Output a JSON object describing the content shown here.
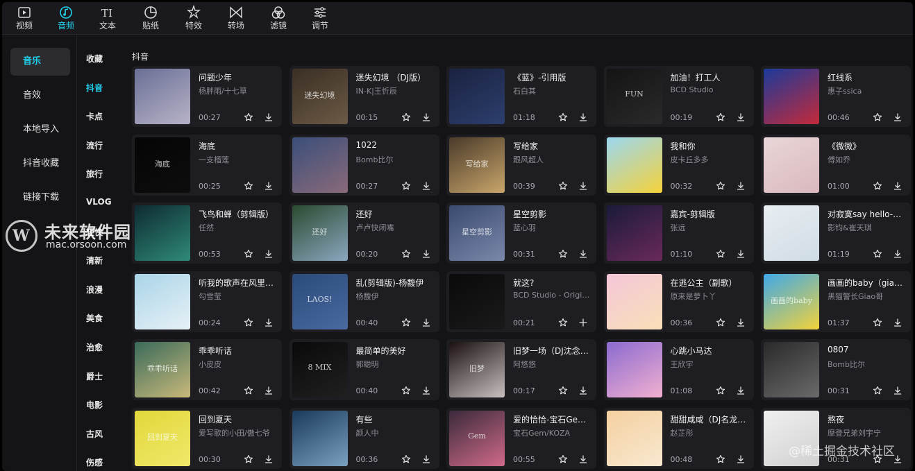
{
  "toolbar": {
    "tools": [
      {
        "label": "视频",
        "icon": "video-icon"
      },
      {
        "label": "音频",
        "icon": "audio-icon"
      },
      {
        "label": "文本",
        "icon": "text-icon"
      },
      {
        "label": "贴纸",
        "icon": "sticker-icon"
      },
      {
        "label": "特效",
        "icon": "effects-icon"
      },
      {
        "label": "转场",
        "icon": "transition-icon"
      },
      {
        "label": "滤镜",
        "icon": "filter-icon"
      },
      {
        "label": "调节",
        "icon": "adjust-icon"
      }
    ],
    "active": "音频",
    "accent": "#22d3ee"
  },
  "sidebar": {
    "items": [
      {
        "label": "音乐"
      },
      {
        "label": "音效"
      },
      {
        "label": "本地导入"
      },
      {
        "label": "抖音收藏"
      },
      {
        "label": "链接下载"
      }
    ],
    "active": "音乐"
  },
  "categories": {
    "items": [
      "收藏",
      "抖音",
      "卡点",
      "流行",
      "旅行",
      "VLOG",
      "轻快",
      "清新",
      "浪漫",
      "美食",
      "治愈",
      "爵士",
      "电影",
      "古风",
      "伤感"
    ],
    "active": "抖音"
  },
  "section": {
    "title": "抖音"
  },
  "songs": [
    {
      "title": "问题少年",
      "artist": "杨胖雨/十七草",
      "duration": "00:27",
      "cover": "#6a6f95",
      "cover2": "#b7b3c8",
      "action": "download"
    },
    {
      "title": "迷失幻境 （DJ版）",
      "artist": "IN-K|王忻辰",
      "duration": "00:15",
      "cover": "#3a2e24",
      "cover2": "#6b5a45",
      "action": "download"
    },
    {
      "title": "《蓝》-引用版",
      "artist": "石白其",
      "duration": "01:18",
      "cover": "#1a2240",
      "cover2": "#2d3f6e",
      "action": "download"
    },
    {
      "title": "加油！打工人",
      "artist": "BCD Studio",
      "duration": "00:19",
      "cover": "#141414",
      "cover2": "#2a2a2a",
      "action": "download"
    },
    {
      "title": "红线系",
      "artist": "惠子ssica",
      "duration": "00:46",
      "cover": "#1b3a9a",
      "cover2": "#c42a3a",
      "action": "download"
    },
    {
      "title": "海底",
      "artist": "一支榴莲",
      "duration": "00:25",
      "cover": "#050505",
      "cover2": "#0d0d0d",
      "action": "download"
    },
    {
      "title": "1022",
      "artist": "Bomb比尔",
      "duration": "00:27",
      "cover": "#3a4f7a",
      "cover2": "#8a6a7a",
      "action": "download"
    },
    {
      "title": "写给家",
      "artist": "跟风超人",
      "duration": "00:39",
      "cover": "#4a3a2a",
      "cover2": "#c9a66b",
      "action": "download"
    },
    {
      "title": "我和你",
      "artist": "皮卡丘多多",
      "duration": "00:32",
      "cover": "#9ad6f0",
      "cover2": "#f5d23a",
      "action": "download"
    },
    {
      "title": "《微微》",
      "artist": "傅如乔",
      "duration": "01:00",
      "cover": "#e9d6d8",
      "cover2": "#d9b8be",
      "action": "download"
    },
    {
      "title": "飞鸟和蝉（剪辑版）",
      "artist": "任然",
      "duration": "00:53",
      "cover": "#0e2a30",
      "cover2": "#2f8a7a",
      "action": "download"
    },
    {
      "title": "还好",
      "artist": "卢卢快闭嘴",
      "duration": "00:20",
      "cover": "#2b4a2f",
      "cover2": "#8aa7c0",
      "action": "download"
    },
    {
      "title": "星空剪影",
      "artist": "蓝心羽",
      "duration": "00:31",
      "cover": "#3a4a6e",
      "cover2": "#7a88aa",
      "action": "download"
    },
    {
      "title": "嘉宾-剪辑版",
      "artist": "张远",
      "duration": "01:10",
      "cover": "#1a1a3a",
      "cover2": "#6a2a5a",
      "action": "download"
    },
    {
      "title": "对寂寞say hello-剪辑版",
      "artist": "影钧&崔天琪",
      "duration": "01:19",
      "cover": "#e8eef2",
      "cover2": "#cfdbe3",
      "action": "download"
    },
    {
      "title": "听我的歌声在风里飘扬",
      "artist": "勾雪莹",
      "duration": "00:24",
      "cover": "#a9d4e8",
      "cover2": "#e7f1f6",
      "action": "download"
    },
    {
      "title": "乱(剪辑版)-杨馥伊",
      "artist": "杨馥伊",
      "duration": "00:40",
      "cover": "#2a4a7a",
      "cover2": "#4a6aa0",
      "action": "download"
    },
    {
      "title": "就这?",
      "artist": "BCD Studio - Original",
      "duration": "00:21",
      "cover": "#0a0a0a",
      "cover2": "#1a1a1a",
      "action": "add"
    },
    {
      "title": "在逃公主（副歌）",
      "artist": "原来是萝卜丫",
      "duration": "00:36",
      "cover": "#f4c6d8",
      "cover2": "#f8e0b8",
      "action": "download"
    },
    {
      "title": "画画的baby（giao哥版）",
      "artist": "黑猫警长Giao哥",
      "duration": "01:37",
      "cover": "#3fa9e8",
      "cover2": "#f2d23a",
      "action": "download"
    },
    {
      "title": "乖乖听话",
      "artist": "小皮皮",
      "duration": "00:42",
      "cover": "#3a6a5a",
      "cover2": "#c9b97a",
      "action": "download"
    },
    {
      "title": "最简单的美好",
      "artist": "郭聪明",
      "duration": "00:40",
      "cover": "#0a0a0a",
      "cover2": "#202020",
      "action": "download"
    },
    {
      "title": "旧梦一场（DJ沈念版）",
      "artist": "阿悠悠",
      "duration": "00:17",
      "cover": "#1a1010",
      "cover2": "#c9c0c0",
      "action": "download"
    },
    {
      "title": "心跳小马达",
      "artist": "王欣宇",
      "duration": "01:08",
      "cover": "#8a6ad0",
      "cover2": "#f2b0d0",
      "action": "download"
    },
    {
      "title": "0807",
      "artist": "Bomb比尔",
      "duration": "00:31",
      "cover": "#2a2a2a",
      "cover2": "#6a6a6a",
      "action": "download"
    },
    {
      "title": "回到夏天",
      "artist": "爱写歌的小田/傲七爷",
      "duration": "00:30",
      "cover": "#e0d83a",
      "cover2": "#f0e86a",
      "action": "download"
    },
    {
      "title": "有些",
      "artist": "颜人中",
      "duration": "00:36",
      "cover": "#1a3a5a",
      "cover2": "#7aa0c0",
      "action": "download"
    },
    {
      "title": "爱的恰恰-宝石Gem/KOZA",
      "artist": "宝石Gem/KOZA",
      "duration": "00:55",
      "cover": "#3a2a3a",
      "cover2": "#d06a8a",
      "action": "download"
    },
    {
      "title": "甜甜咸咸（DJ名龙版）",
      "artist": "赵芷彤",
      "duration": "00:48",
      "cover": "#f4d0a0",
      "cover2": "#f8e8d0",
      "action": "download"
    },
    {
      "title": "熬夜",
      "artist": "摩登兄弟刘宇宁",
      "duration": "00:31",
      "cover": "#f0f0f0",
      "cover2": "#d0d0d0",
      "action": "download"
    }
  ],
  "cover_texts": {
    "1": "迷失幻境",
    "3": "FUN",
    "5": "海底",
    "7": "写给家",
    "11": "还好",
    "12": "星空剪影",
    "16": "LAOS!",
    "19": "画画的baby",
    "20": "乖乖听话",
    "21": "8 MIX",
    "22": "旧梦",
    "25": "回到夏天",
    "27": "Gem"
  },
  "watermarks": {
    "logo_mark": "W",
    "logo_title": "未来软件园",
    "logo_sub": "mac.orsoon.com",
    "juejin": "@稀土掘金技术社区"
  }
}
